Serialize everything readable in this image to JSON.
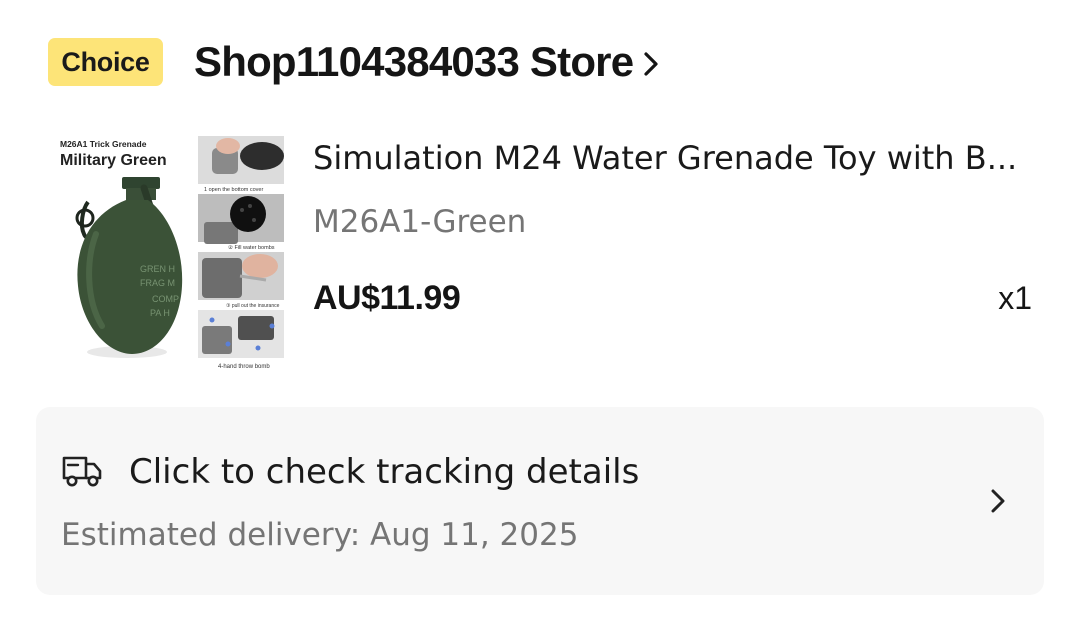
{
  "store": {
    "badge": "Choice",
    "name": "Shop1104384033 Store",
    "chevron_icon": "chevron-right-icon"
  },
  "product": {
    "image": {
      "label_small": "M26A1 Trick Grenade",
      "label_big": "Military Green",
      "body_text_1": "GREN H",
      "body_text_2": "FRAG M",
      "body_text_3": "COMP",
      "body_text_4": "PA H",
      "step1": "1 open the bottom cover",
      "step2": "② Fill water bombs",
      "step3": "③ pull out the insurance",
      "step4": "4-hand throw bomb"
    },
    "title": "Simulation M24 Water Grenade Toy with B...",
    "variant": "M26A1-Green",
    "price": "AU$11.99",
    "quantity": "x1"
  },
  "tracking": {
    "icon": "truck-icon",
    "title": "Click to check tracking details",
    "estimated": "Estimated delivery: Aug 11, 2025",
    "chevron_icon": "chevron-right-icon"
  },
  "colors": {
    "choice_badge": "#fde478",
    "card_background": "#f7f7f7",
    "muted_text": "#757575",
    "primary_text": "#1a1a1a",
    "grenade_green": "#3b5237"
  }
}
